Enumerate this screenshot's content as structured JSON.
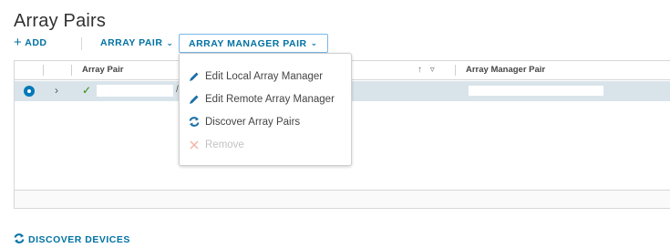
{
  "page": {
    "title": "Array Pairs"
  },
  "toolbar": {
    "add_label": "ADD",
    "array_pair_label": "ARRAY PAIR",
    "array_manager_pair_label": "ARRAY MANAGER PAIR"
  },
  "grid": {
    "columns": [
      "Array Pair",
      "Array Manager Pair"
    ],
    "selected_row": {
      "status": "ok"
    }
  },
  "dropdown": {
    "items": [
      {
        "label": "Edit Local Array Manager",
        "icon": "pencil-icon",
        "enabled": true
      },
      {
        "label": "Edit Remote Array Manager",
        "icon": "pencil-icon",
        "enabled": true
      },
      {
        "label": "Discover Array Pairs",
        "icon": "sync-icon",
        "enabled": true
      },
      {
        "label": "Remove",
        "icon": "close-icon",
        "enabled": false
      }
    ]
  },
  "footer": {
    "discover_devices_label": "DISCOVER DEVICES"
  },
  "colors": {
    "accent": "#0072a3",
    "selected_row": "#d9e4ea",
    "radio": "#0079b8",
    "check": "#2e8b00",
    "disabled": "#c2c2c2"
  }
}
